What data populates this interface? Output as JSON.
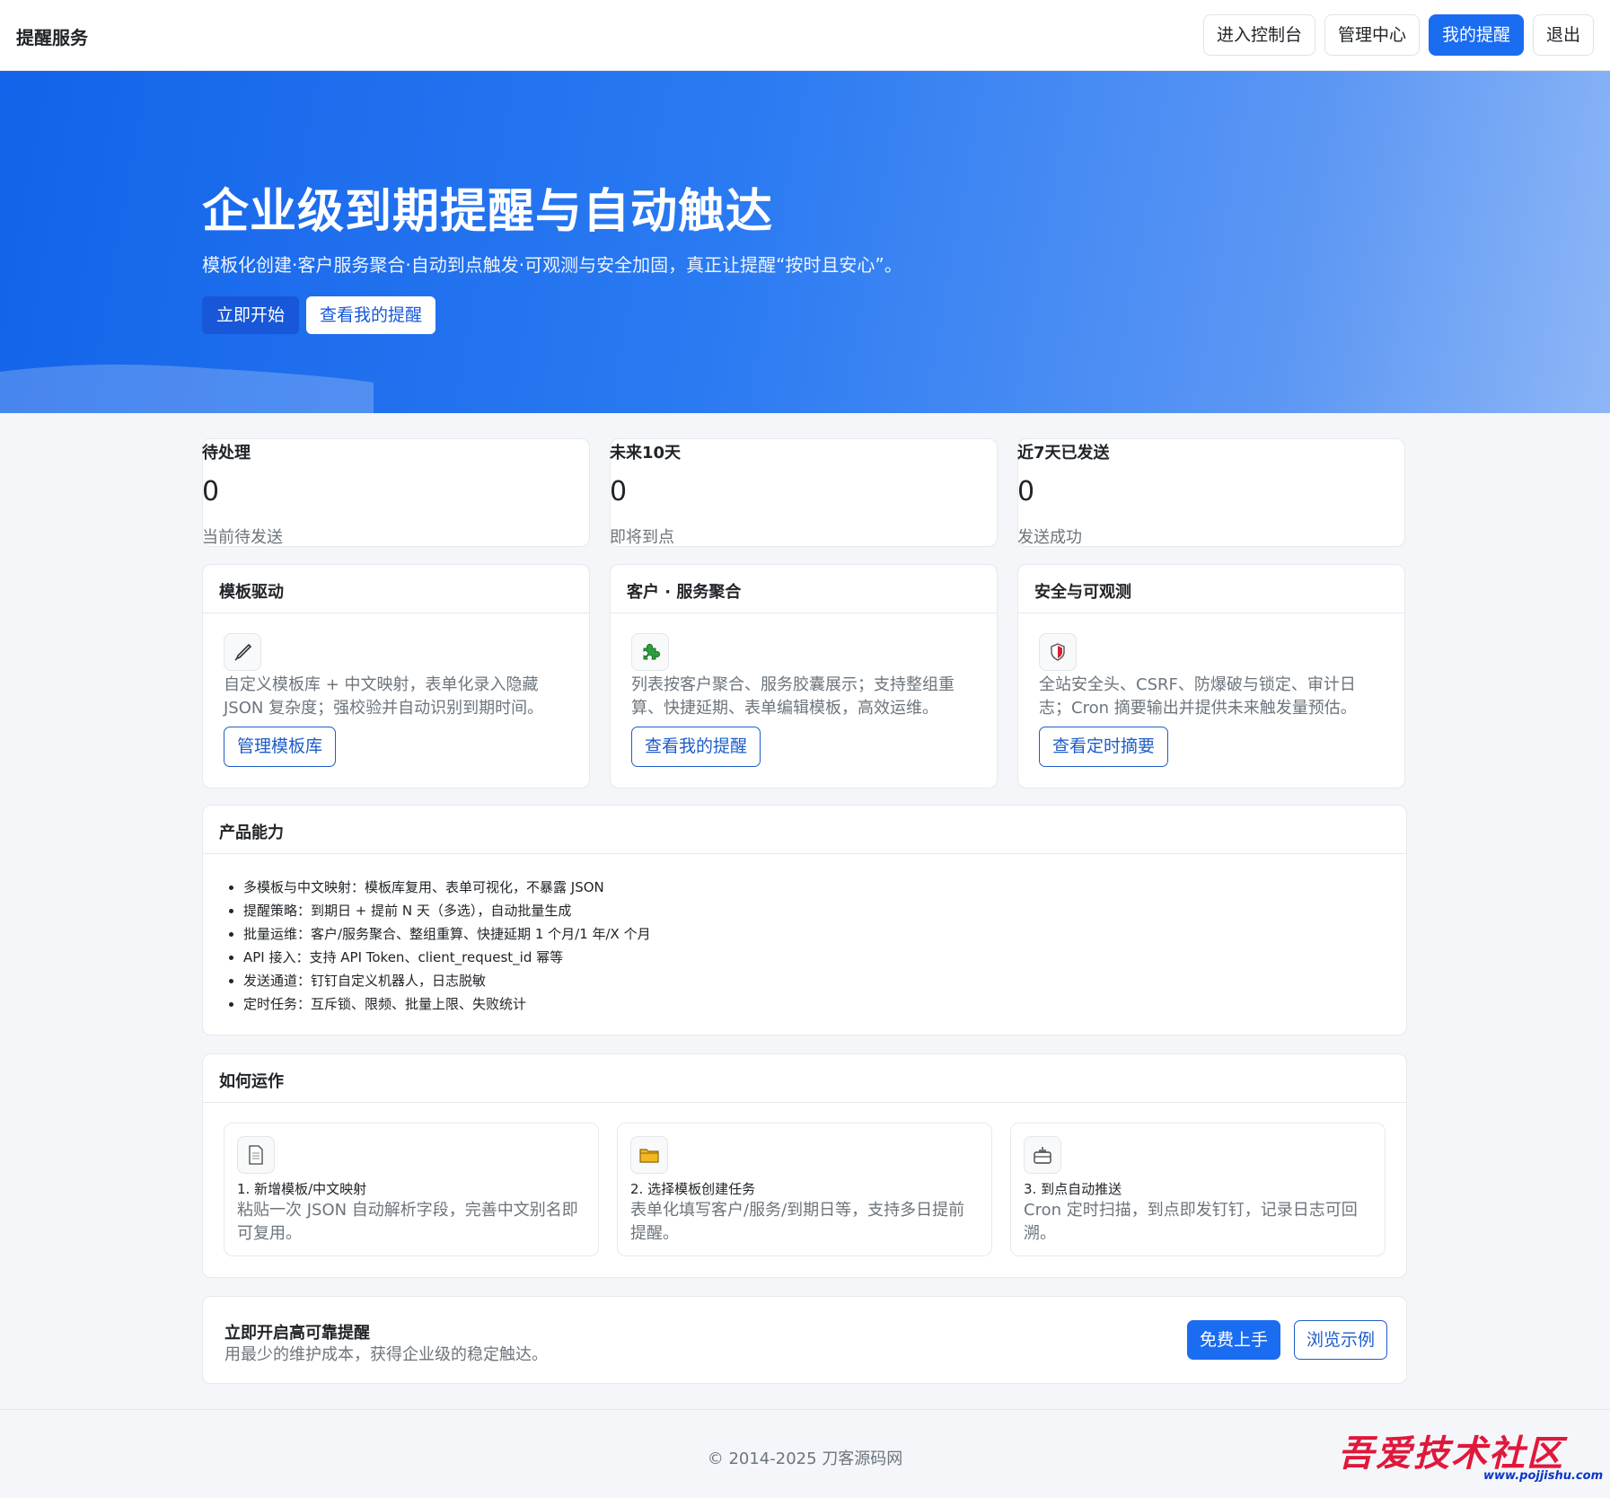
{
  "brand": "提醒服务",
  "nav": [
    "进入控制台",
    "管理中心",
    "我的提醒",
    "退出"
  ],
  "hero": {
    "title": "企业级到期提醒与自动触达",
    "subtitle": "模板化创建·客户服务聚合·自动到点触发·可观测与安全加固，真正让提醒“按时且安心”。",
    "primary": "立即开始",
    "secondary": "查看我的提醒"
  },
  "stats": [
    {
      "title": "待处理",
      "value": "0",
      "sub": "当前待发送"
    },
    {
      "title": "未来10天",
      "value": "0",
      "sub": "即将到点"
    },
    {
      "title": "近7天已发送",
      "value": "0",
      "sub": "发送成功"
    }
  ],
  "features": [
    {
      "title": "模板驱动",
      "icon": "brush-icon",
      "desc": "自定义模板库 + 中文映射，表单化录入隐藏 JSON 复杂度；强校验并自动识别到期时间。",
      "btn": "管理模板库"
    },
    {
      "title": "客户 · 服务聚合",
      "icon": "puzzle-icon",
      "desc": "列表按客户聚合、服务胶囊展示；支持整组重算、快捷延期、表单编辑模板，高效运维。",
      "btn": "查看我的提醒"
    },
    {
      "title": "安全与可观测",
      "icon": "shield-icon",
      "desc": "全站安全头、CSRF、防爆破与锁定、审计日志；Cron 摘要输出并提供未来触发量预估。",
      "btn": "查看定时摘要"
    }
  ],
  "capabilities": {
    "title": "产品能力",
    "items": [
      "多模板与中文映射：模板库复用、表单可视化，不暴露 JSON",
      "提醒策略：到期日 + 提前 N 天（多选），自动批量生成",
      "批量运维：客户/服务聚合、整组重算、快捷延期 1 个月/1 年/X 个月",
      "API 接入：支持 API Token、client_request_id 幂等",
      "发送通道：钉钉自定义机器人，日志脱敏",
      "定时任务：互斥锁、限频、批量上限、失败统计"
    ]
  },
  "how": {
    "title": "如何运作",
    "steps": [
      {
        "icon": "document-icon",
        "title": "1. 新增模板/中文映射",
        "desc": "粘贴一次 JSON 自动解析字段，完善中文别名即可复用。"
      },
      {
        "icon": "folder-icon",
        "title": "2. 选择模板创建任务",
        "desc": "表单化填写客户/服务/到期日等，支持多日提前提醒。"
      },
      {
        "icon": "robot-icon",
        "title": "3. 到点自动推送",
        "desc": "Cron 定时扫描，到点即发钉钉，记录日志可回溯。"
      }
    ]
  },
  "cta": {
    "title": "立即开启高可靠提醒",
    "subtitle": "用最少的维护成本，获得企业级的稳定触达。",
    "primary": "免费上手",
    "secondary": "浏览示例"
  },
  "footer": "© 2014-2025 刀客源码网",
  "watermark": {
    "cn": "吾爱技术社区",
    "url": "www.pojjishu.com"
  },
  "colors": {
    "primary": "#1a6cf0",
    "heroStart": "#1363ea",
    "heroEnd": "#8db6f6",
    "muted": "#6c757d"
  }
}
